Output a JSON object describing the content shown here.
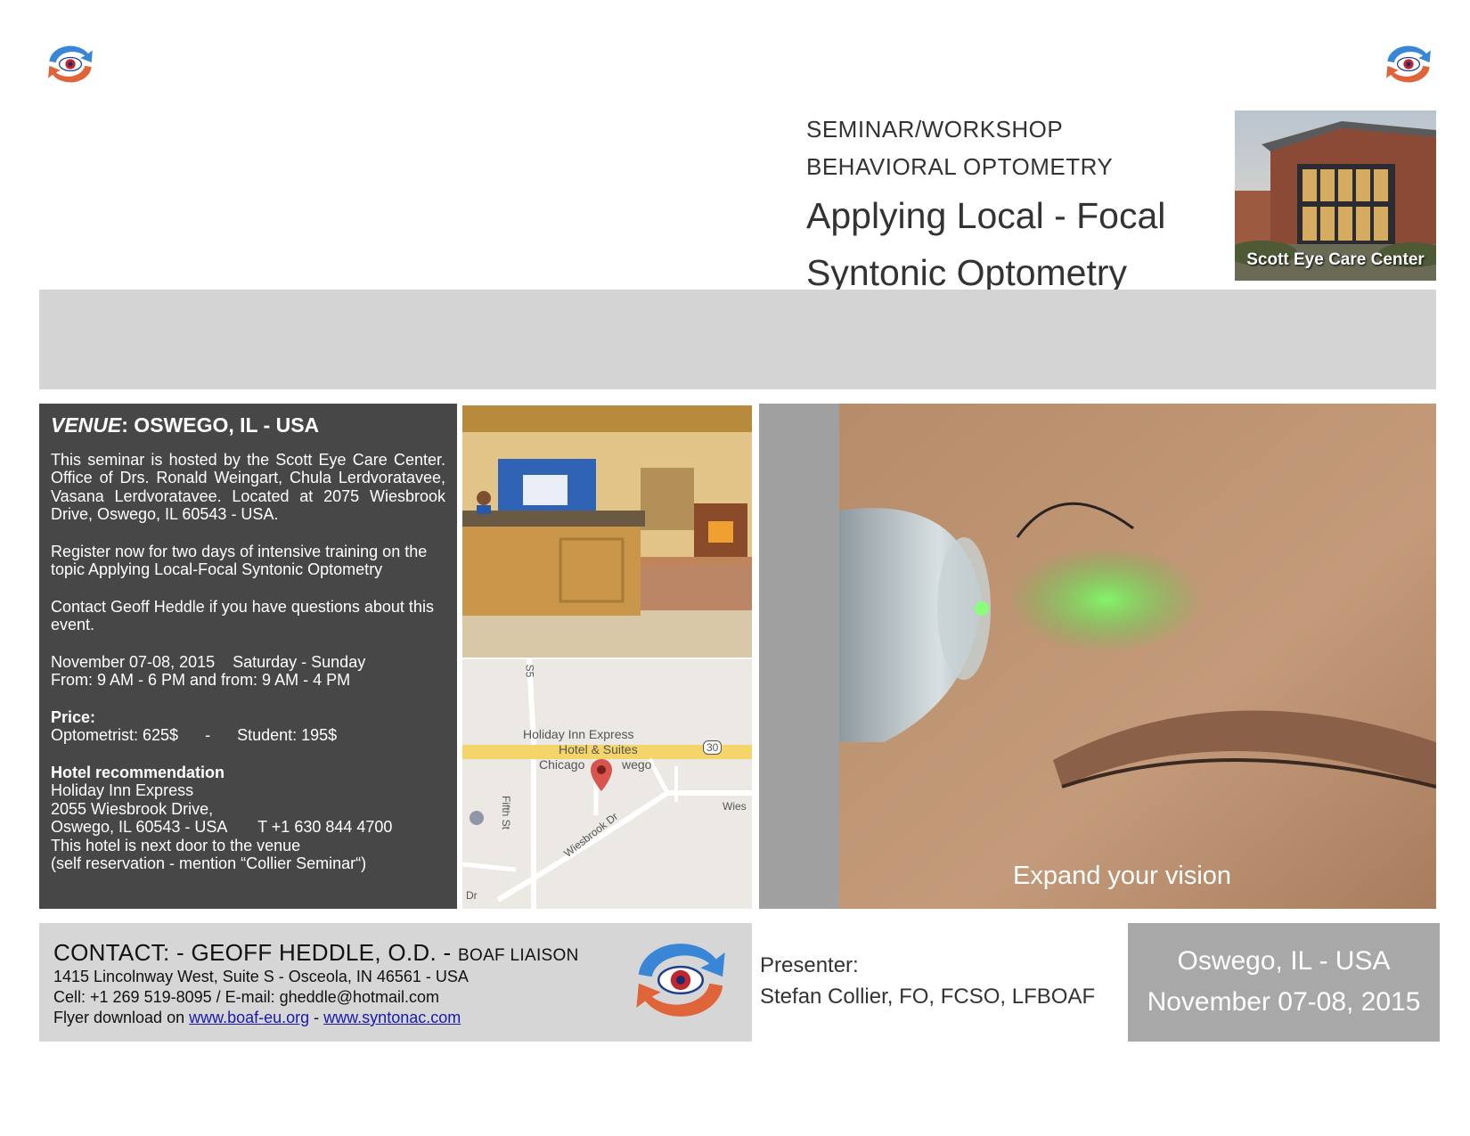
{
  "header": {
    "line1": "SEMINAR/WORKSHOP",
    "line2": "BEHAVIORAL OPTOMETRY",
    "title_line1": "Applying Local - Focal",
    "title_line2": "Syntonic Optometry",
    "building_caption": "Scott Eye Care Center"
  },
  "venue": {
    "heading_label": "VENUE",
    "heading_value": ": OSWEGO, IL - USA",
    "intro": "This seminar is hosted by the Scott Eye Care Center. Office of Drs. Ronald Weingart, Chula Lerdvoratavee, Vasana Lerdvoratavee. Located at 2075 Wiesbrook Drive, Oswego, IL 60543 - USA.",
    "register": "Register now for two days of intensive training on the topic Applying Local-Focal Syntonic Optometry",
    "contact_note": "Contact Geoff Heddle if you have questions about this event.",
    "dates": "November 07-08, 2015    Saturday - Sunday",
    "hours": "From: 9 AM - 6 PM and from: 9 AM - 4 PM",
    "price_label": "Price:",
    "price_value": "Optometrist: 625$      -      Student: 195$",
    "hotel_label": "Hotel recommendation",
    "hotel_name": "Holiday Inn Express",
    "hotel_street": "2055 Wiesbrook Drive,",
    "hotel_city_phone": "Oswego, IL 60543 - USA       T +1 630 844 4700",
    "hotel_note": "This hotel is next door to the venue",
    "hotel_reservation": "(self reservation - mention “Collier Seminar“)"
  },
  "map": {
    "label_hotel_1": "Holiday Inn Express",
    "label_hotel_2": "Hotel & Suites",
    "label_hotel_3": "Chicago",
    "label_hotel_4": "wego",
    "road_shield": "30",
    "street_fifth": "Fifth St",
    "street_wiesbrook": "Wiesbrook Dr",
    "street_wies": "Wies",
    "street_dr": "Dr",
    "street_top": "S5"
  },
  "eye_tagline": "Expand your vision",
  "contact": {
    "title": "CONTACT: - GEOFF HEDDLE, O.D. - ",
    "title_role": "BOAF LIAISON",
    "address": "1415 Lincolnway West, Suite S - Osceola, IN 46561 - USA",
    "phone_email": "Cell: +1 269 519-8095  /  E-mail: gheddle@hotmail.com",
    "download_prefix": "Flyer download on ",
    "link1": "www.boaf-eu.org",
    "separator": " - ",
    "link2": "www.syntonac.com"
  },
  "presenter": {
    "label": "Presenter:",
    "name": "Stefan Collier, FO, FCSO, LFBOAF"
  },
  "event_box": {
    "location": "Oswego, IL - USA",
    "date": "November 07-08, 2015"
  },
  "colors": {
    "venue_bg": "#474747",
    "band_grey": "#d4d4d4",
    "date_box": "#a8a8a8",
    "logo_blue": "#3a86d6",
    "logo_orange": "#e0643a",
    "link_blue": "#1a1aa8"
  }
}
